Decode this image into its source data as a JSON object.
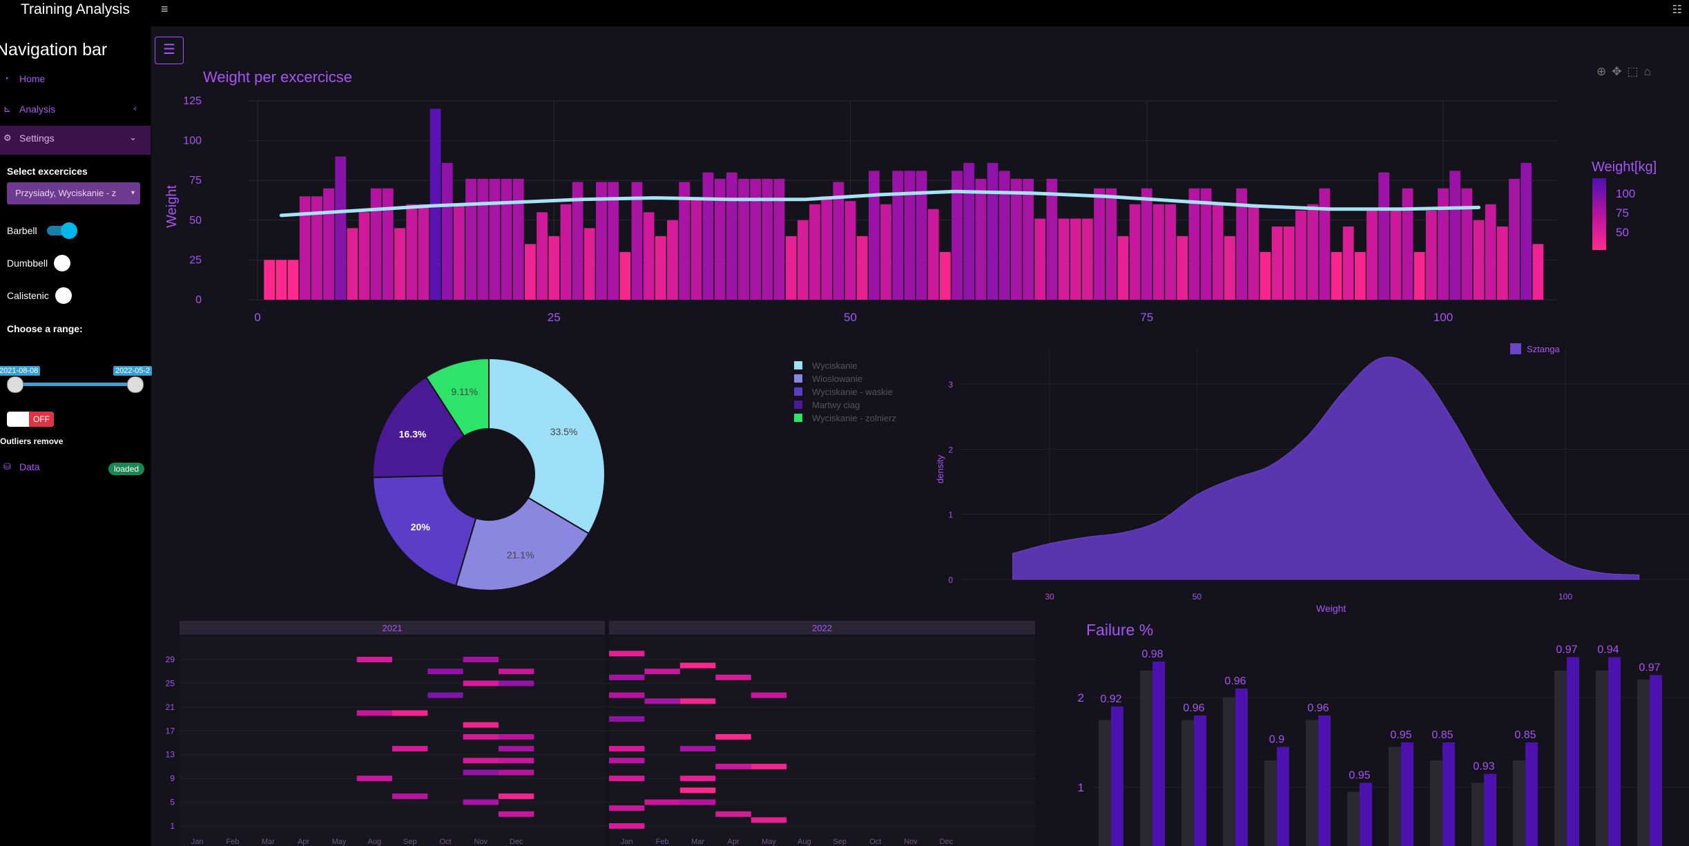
{
  "app": {
    "title": "Training Analysis"
  },
  "sidebar": {
    "title": "Navigation bar",
    "items": [
      {
        "label": "Home",
        "icon": "gauge-icon"
      },
      {
        "label": "Analysis",
        "icon": "chart-line-icon"
      },
      {
        "label": "Settings",
        "icon": "gears-icon"
      },
      {
        "label": "Data",
        "icon": "database-icon"
      }
    ],
    "select_label": "Select excercices",
    "select_value": "Przysiady, Wyciskanie - z",
    "switches": [
      {
        "label": "Barbell",
        "on": true
      },
      {
        "label": "Dumbbell",
        "on": false
      },
      {
        "label": "Calistenic",
        "on": false
      }
    ],
    "range_label": "Choose a range:",
    "range_start": "2021-08-08",
    "range_end": "2022-05-2",
    "outliers_toggle": "OFF",
    "outliers_label": "Outliers remove",
    "data_badge": "loaded"
  },
  "colors": {
    "accent": "#a855f7",
    "pink": "#ff2d8a",
    "purple": "#4d11b0",
    "line": "#a6e3f5"
  },
  "chart_data": [
    {
      "type": "bar",
      "title": "Weight per excercicse",
      "ylabel": "Weight",
      "xlabel": "",
      "xticks": [
        "0",
        "25",
        "50",
        "75",
        "100"
      ],
      "yticks": [
        "0",
        "25",
        "50",
        "75",
        "100",
        "125"
      ],
      "ylim": [
        0,
        125
      ],
      "colorbar_title": "Weight[kg]",
      "colorbar_ticks": [
        "100",
        "75",
        "50"
      ],
      "values": [
        25,
        25,
        25,
        65,
        65,
        70,
        90,
        45,
        55,
        70,
        70,
        45,
        60,
        60,
        120,
        86,
        60,
        76,
        76,
        76,
        76,
        76,
        35,
        55,
        40,
        60,
        74,
        45,
        74,
        74,
        30,
        74,
        55,
        40,
        50,
        74,
        64,
        80,
        76,
        80,
        76,
        76,
        76,
        76,
        40,
        50,
        60,
        65,
        74,
        62,
        40,
        81,
        60,
        81,
        81,
        81,
        57,
        30,
        81,
        86,
        76,
        86,
        81,
        76,
        76,
        51,
        76,
        51,
        51,
        51,
        70,
        70,
        40,
        60,
        70,
        60,
        60,
        40,
        70,
        70,
        60,
        40,
        70,
        60,
        30,
        46,
        46,
        56,
        60,
        70,
        30,
        46,
        30,
        56,
        80,
        56,
        70,
        30,
        56,
        70,
        81,
        70,
        50,
        60,
        46,
        76,
        86,
        35
      ],
      "trend": [
        53,
        56,
        59,
        61,
        63,
        64,
        63,
        63,
        66,
        68,
        67,
        65,
        62,
        59,
        57,
        57,
        58
      ]
    },
    {
      "type": "pie",
      "labels": [
        "Wyciskanie",
        "Wioslowanie",
        "Wyciskanie - waskie",
        "Martwy ciag",
        "Wyciskanie - zolnierz"
      ],
      "values": [
        33.5,
        21.1,
        20,
        16.3,
        9.11
      ],
      "slice_labels": [
        "33.5%",
        "21.1%",
        "20%",
        "16.3%",
        "9.11%"
      ],
      "colors": [
        "#9edff8",
        "#8b86e0",
        "#5b3dc8",
        "#4a1a96",
        "#2ee36a"
      ]
    },
    {
      "type": "area",
      "legend": "Sztanga",
      "xlabel": "Weight",
      "ylabel": "density",
      "xticks": [
        "30",
        "50",
        "100"
      ],
      "yticks": [
        "0",
        "1",
        "2",
        "3"
      ],
      "x": [
        25,
        30,
        35,
        40,
        45,
        50,
        55,
        60,
        65,
        70,
        75,
        80,
        85,
        90,
        95,
        100,
        105,
        110
      ],
      "y": [
        0.4,
        0.55,
        0.65,
        0.72,
        0.9,
        1.3,
        1.55,
        1.75,
        2.2,
        2.9,
        3.4,
        3.2,
        2.4,
        1.4,
        0.65,
        0.25,
        0.1,
        0.07
      ]
    },
    {
      "type": "heatmap",
      "facets": [
        "2021",
        "2022"
      ],
      "yticks": [
        "29",
        "25",
        "21",
        "17",
        "13",
        "9",
        "5",
        "1"
      ],
      "months": [
        "Jan",
        "Feb",
        "Mar",
        "Apr",
        "May",
        "Aug",
        "Sep",
        "Oct",
        "Nov",
        "Dec"
      ]
    },
    {
      "type": "bar",
      "title": "Failure %",
      "yticks": [
        "1",
        "2"
      ],
      "labels": [
        "0.92",
        "0.98",
        "0.96",
        "0.96",
        "0.9",
        "0.96",
        "0.95",
        "0.95",
        "0.85",
        "0.93",
        "0.85",
        "0.97",
        "0.94",
        "0.97"
      ],
      "values": [
        1.9,
        2.4,
        1.8,
        2.1,
        1.45,
        1.8,
        1.05,
        1.5,
        1.5,
        1.15,
        1.5,
        2.45,
        2.45,
        2.25
      ],
      "shadow": [
        1.75,
        2.3,
        1.75,
        2.0,
        1.3,
        1.75,
        0.95,
        1.45,
        1.3,
        1.05,
        1.3,
        2.3,
        2.3,
        2.2
      ]
    }
  ]
}
